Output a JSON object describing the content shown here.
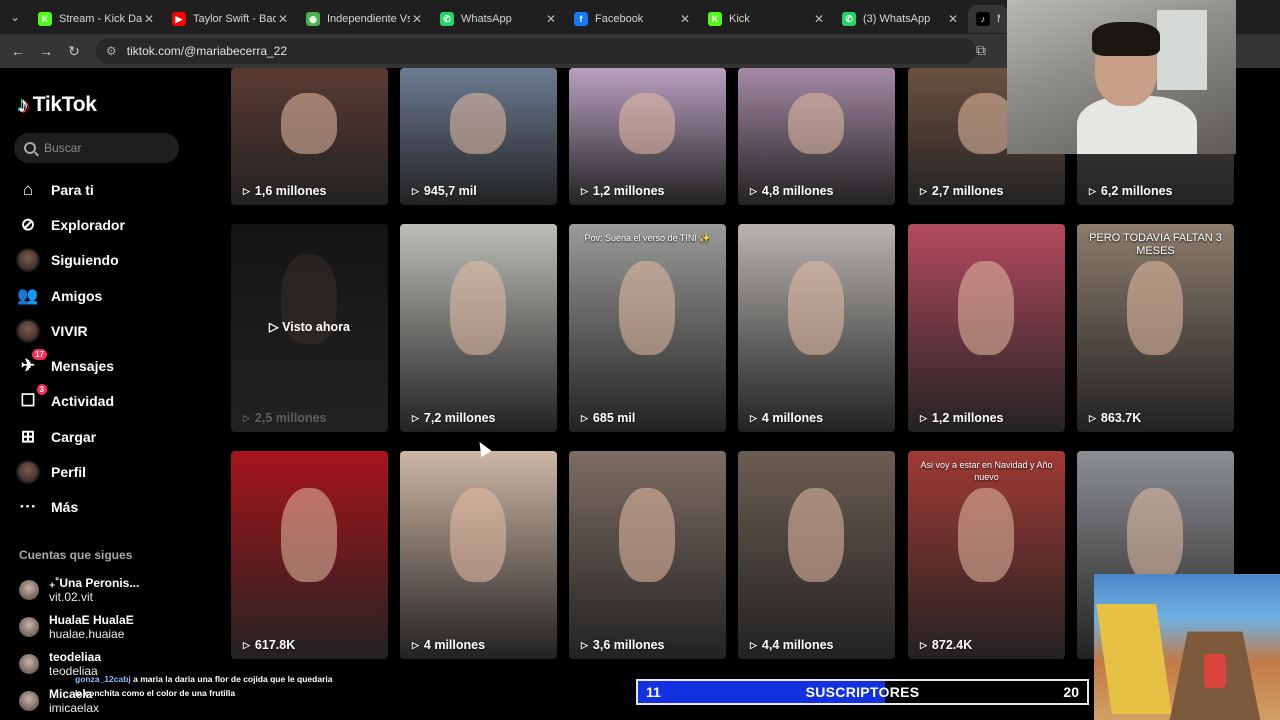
{
  "browser": {
    "tabs": [
      {
        "title": "Stream - Kick Dashboard",
        "icon": "kick-icon",
        "color": "#53fc18",
        "glyph": "K"
      },
      {
        "title": "Taylor Swift - Bad Blood",
        "icon": "youtube-icon",
        "color": "#ff0000",
        "glyph": "▶"
      },
      {
        "title": "Independiente Vs",
        "icon": "globe-icon",
        "color": "#4caf50",
        "glyph": "◉"
      },
      {
        "title": "WhatsApp",
        "icon": "whatsapp-icon",
        "color": "#25d366",
        "glyph": "✆"
      },
      {
        "title": "Facebook",
        "icon": "facebook-icon",
        "color": "#1877f2",
        "glyph": "f"
      },
      {
        "title": "Kick",
        "icon": "kick-icon",
        "color": "#53fc18",
        "glyph": "K"
      },
      {
        "title": "(3) WhatsApp",
        "icon": "whatsapp-icon",
        "color": "#25d366",
        "glyph": "✆"
      },
      {
        "title": "Ma",
        "icon": "tiktok-icon",
        "color": "#000000",
        "glyph": "♪"
      }
    ],
    "url": "tiktok.com/@mariabecerra_22"
  },
  "sidebar": {
    "logo": "TikTok",
    "search_placeholder": "Buscar",
    "menu": [
      {
        "label": "Para ti",
        "icon": "home-icon",
        "glyph": "⌂"
      },
      {
        "label": "Explorador",
        "icon": "compass-icon",
        "glyph": "⊘"
      },
      {
        "label": "Siguiendo",
        "icon": "following-avatar-icon",
        "glyph": ""
      },
      {
        "label": "Amigos",
        "icon": "friends-icon",
        "glyph": "👥"
      },
      {
        "label": "VIVIR",
        "icon": "live-avatar-icon",
        "glyph": ""
      },
      {
        "label": "Mensajes",
        "icon": "messages-icon",
        "glyph": "✈",
        "badge": "17"
      },
      {
        "label": "Actividad",
        "icon": "activity-icon",
        "glyph": "☐",
        "badge": "3"
      },
      {
        "label": "Cargar",
        "icon": "upload-icon",
        "glyph": "⊞"
      },
      {
        "label": "Perfil",
        "icon": "profile-avatar-icon",
        "glyph": ""
      },
      {
        "label": "Más",
        "icon": "more-icon",
        "glyph": "···"
      }
    ],
    "following_title": "Cuentas que sigues",
    "following": [
      {
        "name": "₊˚Una Peronis...",
        "handle": "vit.02.vit"
      },
      {
        "name": "HualaE HualaE",
        "handle": "hualae.huaiae"
      },
      {
        "name": "teodeliaa",
        "handle": "teodeliaa"
      },
      {
        "name": "Micaela",
        "handle": "imicaelax"
      }
    ]
  },
  "videos": [
    {
      "views": "1,6 millones",
      "bg": "#5a3a32"
    },
    {
      "views": "945,7 mil",
      "bg": "#6c7b93"
    },
    {
      "views": "1,2 millones",
      "bg": "#b9a1c2"
    },
    {
      "views": "4,8 millones",
      "bg": "#a58aa4"
    },
    {
      "views": "2,7 millones",
      "bg": "#6b5140"
    },
    {
      "views": "6,2 millones",
      "bg": "#4d4a45"
    },
    {
      "views": "2,5 millones",
      "bg": "#141414",
      "watched": "Visto ahora"
    },
    {
      "views": "7,2 millones",
      "bg": "#bdbdb8"
    },
    {
      "views": "685 mil",
      "bg": "#9a9a98",
      "caption": "Pov: Suena el verso de TINI ✨"
    },
    {
      "views": "4 millones",
      "bg": "#b8b4b0"
    },
    {
      "views": "1,2 millones",
      "bg": "#b34a5e"
    },
    {
      "views": "863.7K",
      "bg": "#8c7c6c",
      "caption": "PERO TODAVIA FALTAN 3 MESES"
    },
    {
      "views": "617.8K",
      "bg": "#a7141d"
    },
    {
      "views": "4 millones",
      "bg": "#cdb6a5"
    },
    {
      "views": "3,6 millones",
      "bg": "#7d6d62"
    },
    {
      "views": "4,4 millones",
      "bg": "#6c5d52"
    },
    {
      "views": "872.4K",
      "bg": "#a03a35",
      "caption": "Asi voy a estar en Navidad y Año nuevo"
    },
    {
      "views": "",
      "bg": "#8b8e92"
    }
  ],
  "chat": {
    "user": "gonza_12cabj",
    "message": "a maria la daria una flor de cojida que le quedaria la conchita como el color de una frutilla"
  },
  "subscriber_goal": {
    "current": "11",
    "label": "SUSCRIPTORES",
    "goal": "20",
    "progress": 0.55
  }
}
